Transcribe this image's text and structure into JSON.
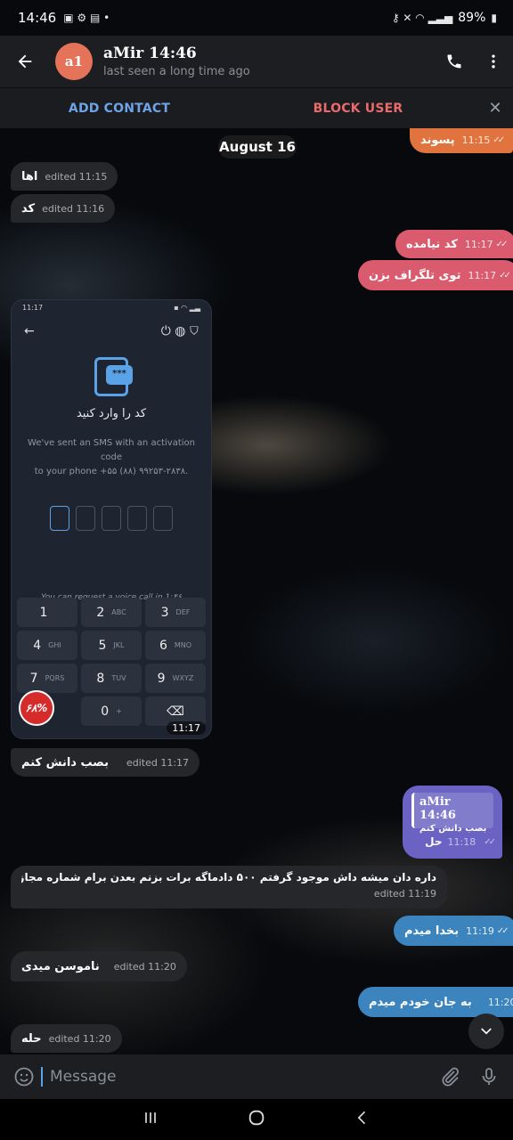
{
  "status_bar": {
    "time": "14:46",
    "battery": "89%"
  },
  "header": {
    "avatar_initials": "a1",
    "title": "aMir 14:46",
    "subtitle": "last seen a long time ago"
  },
  "action_bar": {
    "add_contact": "ADD CONTACT",
    "block_user": "BLOCK USER"
  },
  "chat": {
    "date_chip": "August 16",
    "messages": [
      {
        "text": "پسوند",
        "meta": "11:15"
      },
      {
        "text": "اها",
        "meta": "edited 11:15"
      },
      {
        "text": "کد",
        "meta": "edited 11:16"
      },
      {
        "text": "کد نیامده",
        "meta": "11:17"
      },
      {
        "text": "توی تلگراف بزن",
        "meta": "11:17"
      },
      {
        "text": "بصب دانش کنم",
        "meta": "edited 11:17"
      },
      {
        "text": "حل",
        "meta": "11:18"
      },
      {
        "text": "داره دان میشه داش موجود گرفتم ۵۰۰ دادماگه برات بزنم بعدن برام شماره مجازی میدی",
        "meta": "edited 11:19"
      },
      {
        "text": "بخدا میدم",
        "meta": "11:19"
      },
      {
        "text": "ناموسن میدی",
        "meta": "edited 11:20"
      },
      {
        "text": "به جان خودم میدم",
        "meta": "11:20"
      },
      {
        "text": "حله",
        "meta": "edited 11:20"
      }
    ],
    "reply": {
      "name": "aMir 14:46",
      "text": "بصب دانش کنم"
    }
  },
  "screenshot": {
    "status_time": "11:17",
    "title": "کد را وارد کنید",
    "desc_line1": "We've sent an SMS with an activation code",
    "desc_line2": "to your phone +۵۵ (۸۸) ۹۹۲۵۳-۲۸۳۸.",
    "voice_call": "You can request a voice call in 1:۴۶",
    "time": "11:17",
    "badge": "۶۸%",
    "keys": [
      {
        "num": "1",
        "sub": ""
      },
      {
        "num": "2",
        "sub": "ABC"
      },
      {
        "num": "3",
        "sub": "DEF"
      },
      {
        "num": "4",
        "sub": "GHI"
      },
      {
        "num": "5",
        "sub": "JKL"
      },
      {
        "num": "6",
        "sub": "MNO"
      },
      {
        "num": "7",
        "sub": "PQRS"
      },
      {
        "num": "8",
        "sub": "TUV"
      },
      {
        "num": "9",
        "sub": "WXYZ"
      },
      {
        "num": "",
        "sub": ""
      },
      {
        "num": "0",
        "sub": "+"
      },
      {
        "num": "⌫",
        "sub": ""
      }
    ]
  },
  "input": {
    "placeholder": "Message"
  }
}
